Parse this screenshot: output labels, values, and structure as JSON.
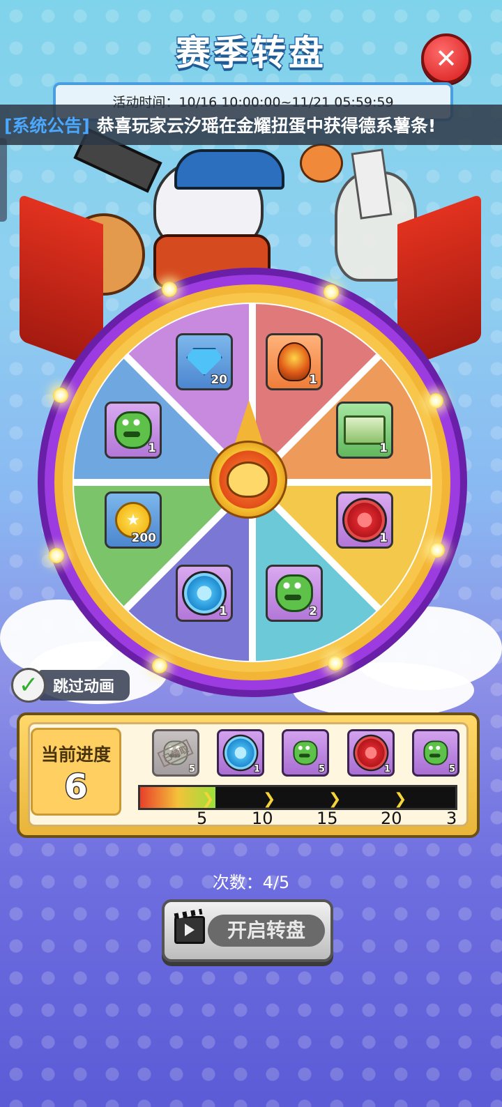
{
  "header": {
    "title": "赛季转盘",
    "close_icon": "close-icon",
    "time_label": "活动时间：",
    "time_range": "10/16 10:00:00~11/21 05:59:59"
  },
  "notice": {
    "tag": "[系统公告]",
    "message": "恭喜玩家云汐瑶在金耀扭蛋中获得德系薯条!"
  },
  "wheel": {
    "prizes": [
      {
        "icon": "diamond-icon",
        "count": "20",
        "frame": "blue"
      },
      {
        "icon": "rocket-icon",
        "count": "1",
        "frame": "orange"
      },
      {
        "icon": "frog-icon",
        "count": "1",
        "frame": "purple"
      },
      {
        "icon": "cash-icon",
        "count": "1",
        "frame": "green"
      },
      {
        "icon": "gold-coin-icon",
        "count": "200",
        "frame": "blue"
      },
      {
        "icon": "red-disc-icon",
        "count": "1",
        "frame": "purple"
      },
      {
        "icon": "blue-disc-icon",
        "count": "1",
        "frame": "purple"
      },
      {
        "icon": "frog-icon",
        "count": "2",
        "frame": "purple"
      }
    ]
  },
  "skip": {
    "label": "跳过动画",
    "checked": true
  },
  "progress": {
    "current_label": "当前进度",
    "current_value": "6",
    "claimed_stamp": "已领取",
    "milestones": [
      {
        "icon": "frog-icon",
        "count": "5",
        "claimed": true
      },
      {
        "icon": "blue-disc-icon",
        "count": "1",
        "claimed": false
      },
      {
        "icon": "frog-icon",
        "count": "5",
        "claimed": false
      },
      {
        "icon": "red-disc-icon",
        "count": "1",
        "claimed": false
      },
      {
        "icon": "frog-icon",
        "count": "5",
        "claimed": false
      }
    ],
    "ticks": [
      "5",
      "10",
      "15",
      "20",
      "3"
    ],
    "fill_fraction": 0.24
  },
  "spins": {
    "text": "次数：4/5"
  },
  "start_button": {
    "label": "开启转盘",
    "icon": "clapperboard-icon"
  },
  "colors": {
    "notice_tag": "#4aa8ff",
    "wheel_rim": "#8b2fd6",
    "wheel_gold": "#f3b535"
  }
}
